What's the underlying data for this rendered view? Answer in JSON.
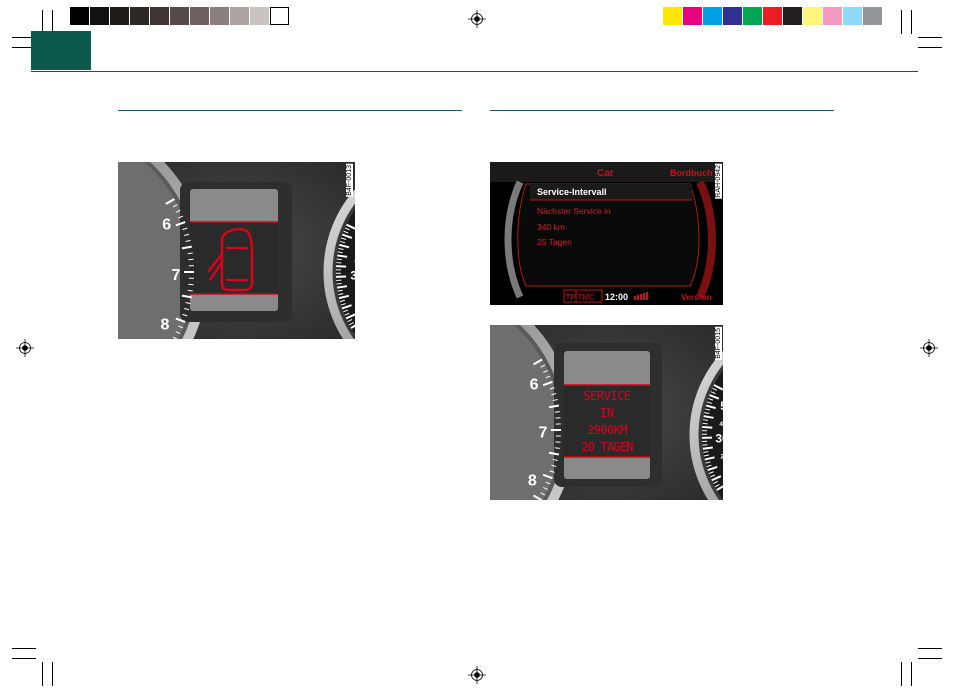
{
  "colors": {
    "accent_green": "#0b5a4b",
    "gray_bar": [
      "#000000",
      "#111111",
      "#1e1b1a",
      "#2d2725",
      "#3e3533",
      "#564b49",
      "#6d6260",
      "#8a7f7d",
      "#aea4a2",
      "#cbc3c1",
      "#ffffff"
    ],
    "color_bar": [
      "#ffe600",
      "#e6007e",
      "#00a0e3",
      "#2e3192",
      "#00a651",
      "#ed1c24",
      "#231f20",
      "#fff57a",
      "#f49ac1",
      "#8ed8f8",
      "#939598"
    ]
  },
  "figures": {
    "door_warning": {
      "code": "B4F-0013",
      "tick_labels_left": [
        "6",
        "7",
        "8"
      ],
      "tick_labels_right": [
        "50",
        "40",
        "30",
        "20",
        "10"
      ],
      "icon": "car-door-open-icon"
    },
    "mmi_service": {
      "code": "RAH-0942",
      "menu_title": "Car",
      "menu_right": "Bordbuch",
      "header": "Service-Intervall",
      "lines": [
        "Nächster Service in",
        "340 km",
        "25 Tagen"
      ],
      "status_tp": "TP",
      "status_tmc": "TMC",
      "status_time": "12:00",
      "bottom_right": "Version"
    },
    "cluster_service": {
      "code": "B4F-0015",
      "tick_labels_left": [
        "6",
        "7",
        "8"
      ],
      "tick_labels_right": [
        "50",
        "40",
        "30",
        "20",
        "10"
      ],
      "lines": [
        "SERVICE",
        "IN",
        "2900KM",
        "20 TAGEN"
      ]
    }
  }
}
